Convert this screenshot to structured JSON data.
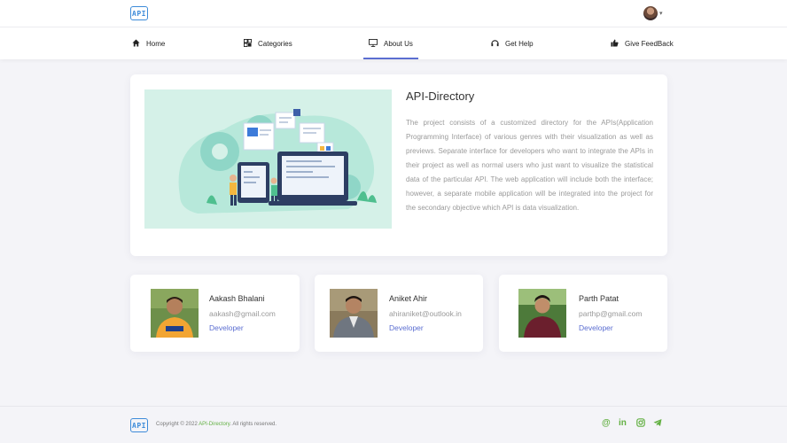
{
  "header": {
    "logo_text": "API",
    "avatar_icon": "user-avatar",
    "dropdown_icon": "chevron-down-icon"
  },
  "nav": {
    "items": [
      {
        "label": "Home",
        "icon": "home-icon"
      },
      {
        "label": "Categories",
        "icon": "grid-icon"
      },
      {
        "label": "About Us",
        "icon": "monitor-icon"
      },
      {
        "label": "Get Help",
        "icon": "headset-icon"
      },
      {
        "label": "Give FeedBack",
        "icon": "thumbs-up-icon"
      }
    ],
    "active": "About Us",
    "active_color": "#5b6ed1"
  },
  "about": {
    "title": "API-Directory",
    "description": "The project consists of a customized directory for the APIs(Application Programming Interface) of various genres with their visualization as well as previews. Separate interface for developers who want to integrate the APIs in their project as well as normal users who just want to visualize the statistical data of the particular API. The web application will include both the interface; however, a separate mobile application will be integrated into the project for the secondary objective which API is data visualization."
  },
  "team": [
    {
      "name": "Aakash Bhalani",
      "email": "aakash@gmail.com",
      "role": "Developer"
    },
    {
      "name": "Aniket Ahir",
      "email": "ahiraniket@outlook.in",
      "role": "Developer"
    },
    {
      "name": "Parth Patat",
      "email": "parthp@gmail.com",
      "role": "Developer"
    }
  ],
  "footer": {
    "logo_text": "API",
    "copyright_prefix": "Copyright © 2022",
    "brand": "API-Directory",
    "copyright_suffix": ". All rights reserved.",
    "social_icons": [
      "at-icon",
      "linkedin-icon",
      "instagram-icon",
      "telegram-icon"
    ],
    "accent_color": "#63b043"
  }
}
